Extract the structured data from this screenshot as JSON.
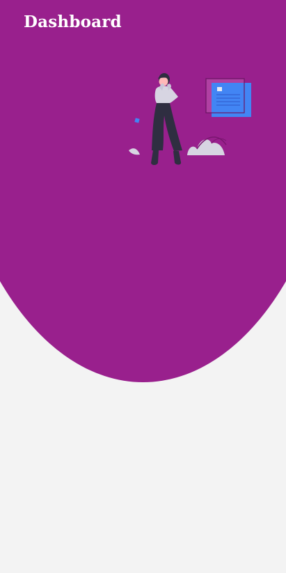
{
  "header": {
    "title": "Dashboard"
  },
  "theme": {
    "primary": "#99208d",
    "background": "#f3f3f3",
    "title_color": "#ffffff",
    "card_accent": "#4285f4",
    "figure_dark": "#2f2e41",
    "figure_light": "#d7d5e2"
  },
  "illustration": {
    "name": "woman-with-document-illustration"
  }
}
